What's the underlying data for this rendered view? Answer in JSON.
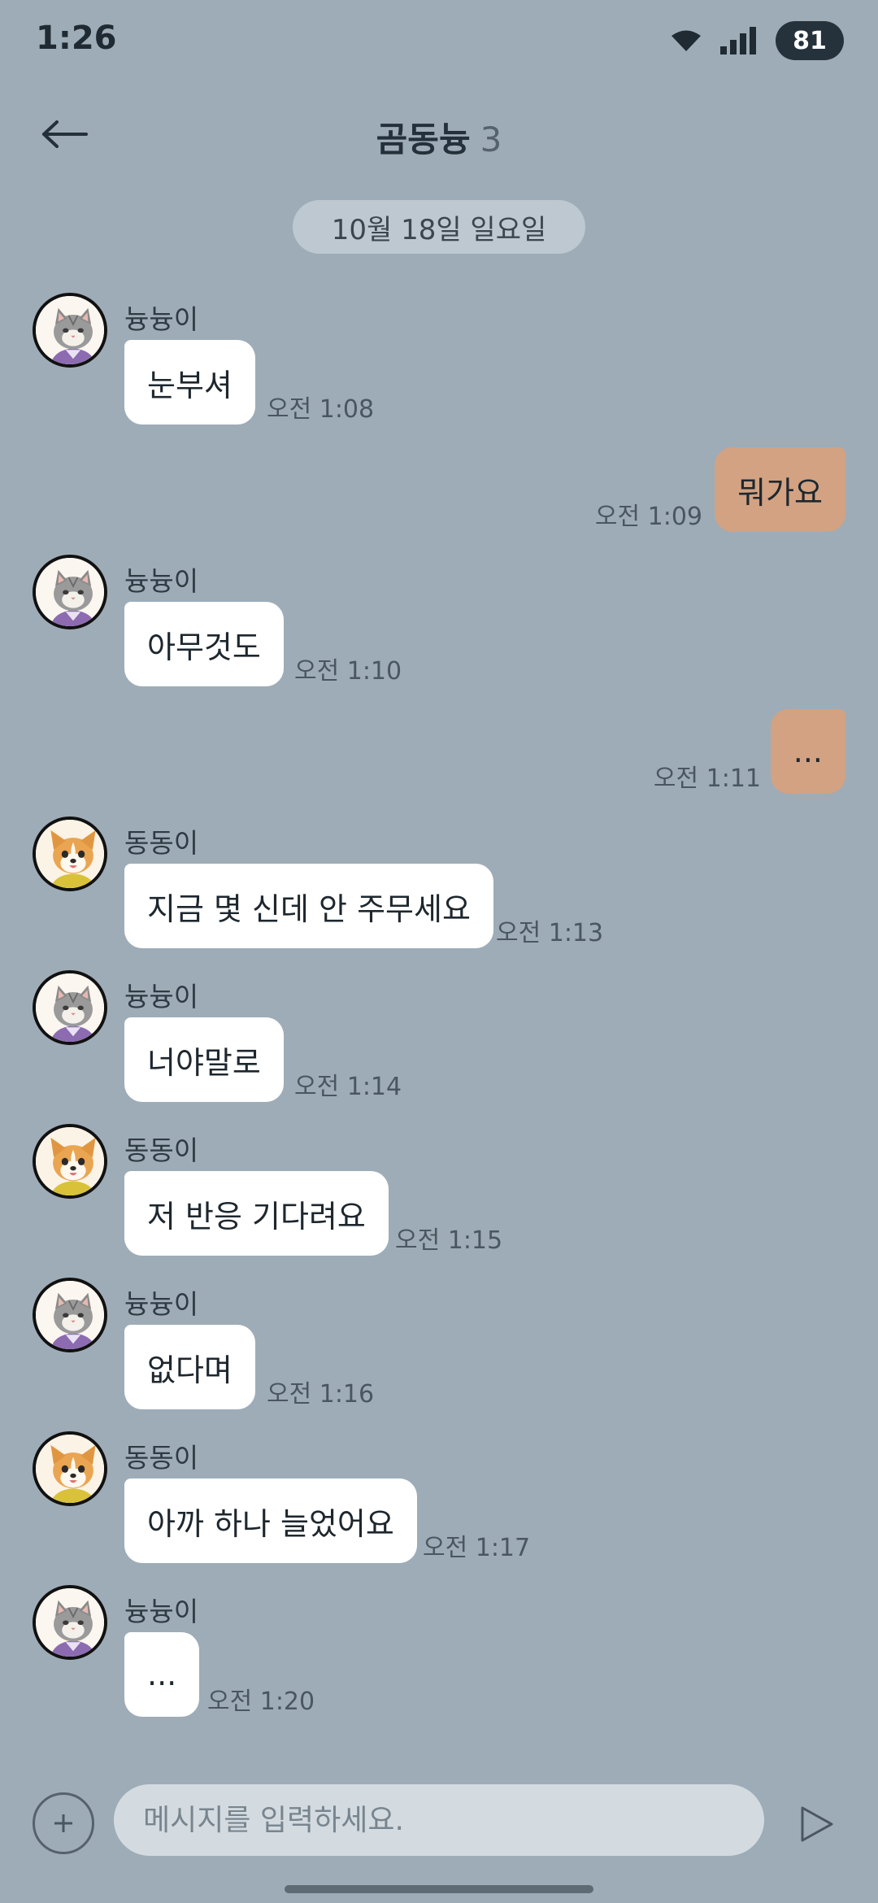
{
  "status_bar": {
    "time": "1:26",
    "battery": "81",
    "icons": [
      "wifi-icon",
      "signal-icon"
    ]
  },
  "header": {
    "title": "곰동늉",
    "member_count": "3",
    "back_icon": "arrow-left-icon"
  },
  "date_divider": "10월 18일 일요일",
  "messages": [
    {
      "sender": "늉늉이",
      "text": "눈부셔",
      "time": "오전 1:08",
      "direction": "in",
      "avatar": "cat"
    },
    {
      "text": "뭐가요",
      "time": "오전 1:09",
      "direction": "out"
    },
    {
      "sender": "늉늉이",
      "text": "아무것도",
      "time": "오전 1:10",
      "direction": "in",
      "avatar": "cat"
    },
    {
      "text": "...",
      "time": "오전 1:11",
      "direction": "out"
    },
    {
      "sender": "동동이",
      "text": "지금 몇 신데 안 주무세요",
      "time": "오전 1:13",
      "direction": "in",
      "avatar": "dog"
    },
    {
      "sender": "늉늉이",
      "text": "너야말로",
      "time": "오전 1:14",
      "direction": "in",
      "avatar": "cat"
    },
    {
      "sender": "동동이",
      "text": "저 반응 기다려요",
      "time": "오전 1:15",
      "direction": "in",
      "avatar": "dog"
    },
    {
      "sender": "늉늉이",
      "text": "없다며",
      "time": "오전 1:16",
      "direction": "in",
      "avatar": "cat"
    },
    {
      "sender": "동동이",
      "text": "아까 하나 늘었어요",
      "time": "오전 1:17",
      "direction": "in",
      "avatar": "dog"
    },
    {
      "sender": "늉늉이",
      "text": "...",
      "time": "오전 1:20",
      "direction": "in",
      "avatar": "cat"
    }
  ],
  "composer": {
    "placeholder": "메시지를 입력하세요.",
    "plus_icon": "plus-icon",
    "send_icon": "send-icon"
  },
  "colors": {
    "background": "#9eacb7",
    "incoming_bubble": "#ffffff",
    "outgoing_bubble": "#d2a282",
    "date_pill": "#bdc8d0",
    "input": "#d3dbe1"
  }
}
